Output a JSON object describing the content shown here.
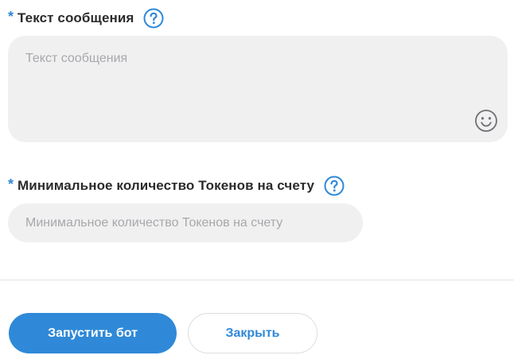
{
  "message_field": {
    "required_mark": "*",
    "label": "Текст сообщения",
    "placeholder": "Текст сообщения",
    "help_icon": "question-circle-icon",
    "emoji_icon": "smiley-icon"
  },
  "tokens_field": {
    "required_mark": "*",
    "label": "Минимальное количество Токенов на счету",
    "placeholder": "Минимальное количество Токенов на счету",
    "help_icon": "question-circle-icon"
  },
  "actions": {
    "start_label": "Запустить бот",
    "close_label": "Закрыть"
  },
  "colors": {
    "accent": "#2f89d8",
    "field_bg": "#f0f0f1",
    "placeholder": "#a7a8ab",
    "label": "#2b2b2b"
  }
}
